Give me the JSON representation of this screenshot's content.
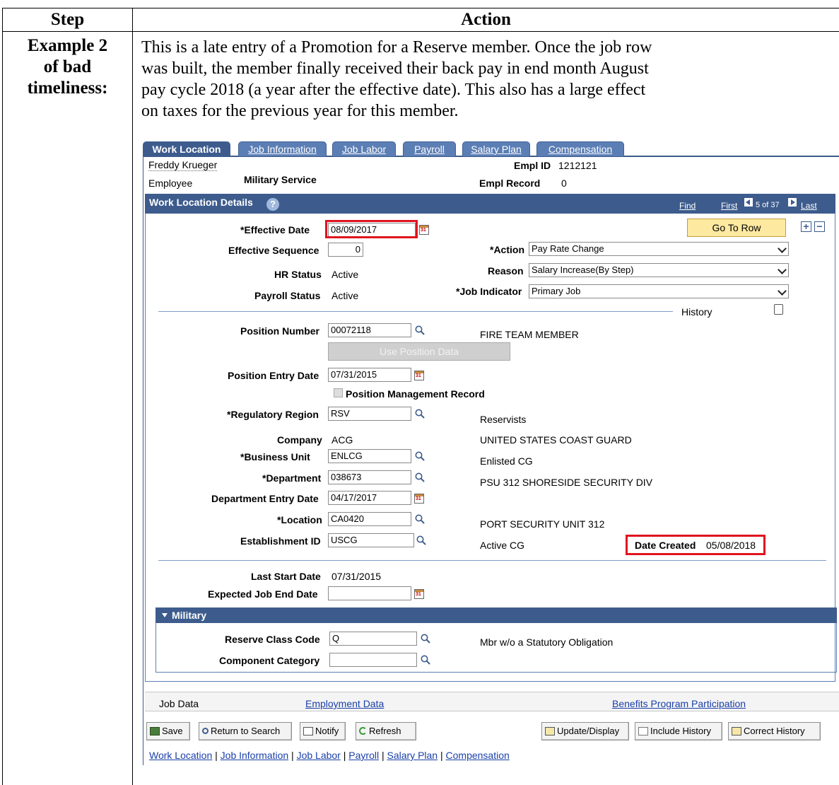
{
  "table": {
    "col_step": "Step",
    "col_action": "Action",
    "step_label_1": "Example 2",
    "step_label_2": "of bad",
    "step_label_3": "timeliness:",
    "para_lines": [
      "This is a late entry of a Promotion for a Reserve member. Once the job row",
      "was built, the member finally received their back pay in end month August",
      "pay cycle 2018 (a year after the effective date). This also has a large effect",
      "on taxes for the previous year for this member."
    ]
  },
  "tabs": [
    "Work Location",
    "Job Information",
    "Job Labor",
    "Payroll",
    "Salary Plan",
    "Compensation"
  ],
  "employee": {
    "name": "Freddy Krueger",
    "type": "Employee",
    "service": "Military Service",
    "empl_id_label": "Empl ID",
    "empl_id": "1212121",
    "empl_record_label": "Empl Record",
    "empl_record": "0"
  },
  "details": {
    "title": "Work Location Details",
    "find": "Find",
    "first": "First",
    "paging": "5 of 37",
    "last": "Last",
    "go_to_row": "Go To Row"
  },
  "fields": {
    "effective_date_label": "*Effective Date",
    "effective_date": "08/09/2017",
    "effective_seq_label": "Effective Sequence",
    "effective_seq": "0",
    "hr_status_label": "HR Status",
    "hr_status": "Active",
    "payroll_status_label": "Payroll Status",
    "payroll_status": "Active",
    "action_label": "*Action",
    "action": "Pay Rate Change",
    "reason_label": "Reason",
    "reason": "Salary Increase(By Step)",
    "job_indicator_label": "*Job Indicator",
    "job_indicator": "Primary Job",
    "history": "History",
    "position_number_label": "Position Number",
    "position_number": "00072118",
    "position_desc": "FIRE TEAM MEMBER",
    "use_position_data": "Use Position Data",
    "position_entry_date_label": "Position Entry Date",
    "position_entry_date": "07/31/2015",
    "position_mgmt_record": "Position Management Record",
    "reg_region_label": "*Regulatory Region",
    "reg_region": "RSV",
    "reg_region_desc": "Reservists",
    "company_label": "Company",
    "company": "ACG",
    "company_desc": "UNITED STATES COAST GUARD",
    "business_unit_label": "*Business Unit",
    "business_unit": "ENLCG",
    "business_unit_desc": "Enlisted CG",
    "department_label": "*Department",
    "department": "038673",
    "department_desc": "PSU 312 SHORESIDE SECURITY DIV",
    "dept_entry_date_label": "Department Entry Date",
    "dept_entry_date": "04/17/2017",
    "location_label": "*Location",
    "location": "CA0420",
    "location_desc": "PORT SECURITY UNIT 312",
    "establishment_label": "Establishment ID",
    "establishment": "USCG",
    "establishment_desc": "Active CG",
    "date_created_label": "Date Created",
    "date_created": "05/08/2018",
    "last_start_label": "Last Start Date",
    "last_start": "07/31/2015",
    "expected_end_label": "Expected Job End Date",
    "expected_end": ""
  },
  "military": {
    "title": "Military",
    "reserve_class_label": "Reserve Class Code",
    "reserve_class": "Q",
    "reserve_class_desc": "Mbr w/o a Statutory Obligation",
    "component_label": "Component Category",
    "component": ""
  },
  "footer": {
    "job_data": "Job Data",
    "employment_data": "Employment Data",
    "benefits": "Benefits Program Participation",
    "save": "Save",
    "return_to_search": "Return to Search",
    "notify": "Notify",
    "refresh": "Refresh",
    "update_display": "Update/Display",
    "include_history": "Include History",
    "correct_history": "Correct History",
    "bottom_links": [
      "Work Location",
      "Job Information",
      "Job Labor",
      "Payroll",
      "Salary Plan",
      "Compensation"
    ]
  }
}
